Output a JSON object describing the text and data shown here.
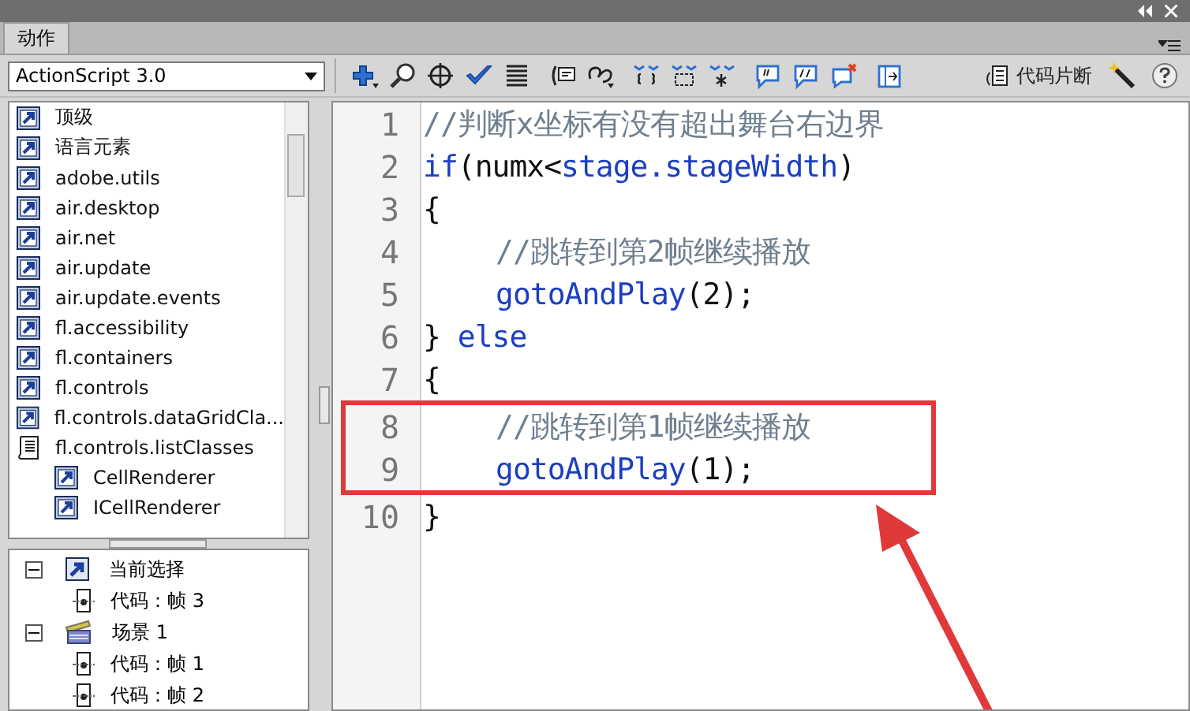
{
  "panel": {
    "tab": {
      "label": "动作",
      "selected": true
    }
  },
  "toolbar": {
    "version_select": {
      "value": "ActionScript 3.0"
    },
    "snippets_label": "代码片断"
  },
  "library": {
    "items": [
      {
        "label": "顶级",
        "kind": "package"
      },
      {
        "label": "语言元素",
        "kind": "package"
      },
      {
        "label": "adobe.utils",
        "kind": "package"
      },
      {
        "label": "air.desktop",
        "kind": "package"
      },
      {
        "label": "air.net",
        "kind": "package"
      },
      {
        "label": "air.update",
        "kind": "package"
      },
      {
        "label": "air.update.events",
        "kind": "package"
      },
      {
        "label": "fl.accessibility",
        "kind": "package"
      },
      {
        "label": "fl.containers",
        "kind": "package"
      },
      {
        "label": "fl.controls",
        "kind": "package"
      },
      {
        "label": "fl.controls.dataGridCla...",
        "kind": "package"
      },
      {
        "label": "fl.controls.listClasses",
        "kind": "book",
        "children": [
          {
            "label": "CellRenderer",
            "kind": "package"
          },
          {
            "label": "ICellRenderer",
            "kind": "package"
          }
        ]
      }
    ]
  },
  "script_navigator": {
    "items": [
      {
        "label": "当前选择",
        "kind": "selection",
        "expanded": true,
        "children": [
          {
            "label": "代码：帧 3",
            "kind": "frame"
          }
        ]
      },
      {
        "label": "场景 1",
        "kind": "scene",
        "expanded": true,
        "children": [
          {
            "label": "代码：帧 1",
            "kind": "frame"
          },
          {
            "label": "代码：帧 2",
            "kind": "frame"
          }
        ]
      }
    ]
  },
  "editor": {
    "lines": [
      {
        "number": "1",
        "highlighted": false,
        "tokens": [
          {
            "text": "//判断x坐标有没有超出舞台右边界",
            "kind": "comment"
          }
        ]
      },
      {
        "number": "2",
        "highlighted": false,
        "tokens": [
          {
            "text": "if",
            "kind": "keyword"
          },
          {
            "text": "(numx<",
            "kind": "plain"
          },
          {
            "text": "stage.stageWidth",
            "kind": "keyword"
          },
          {
            "text": ")",
            "kind": "plain"
          }
        ]
      },
      {
        "number": "3",
        "highlighted": false,
        "tokens": [
          {
            "text": "{",
            "kind": "plain"
          }
        ]
      },
      {
        "number": "4",
        "highlighted": false,
        "indented": true,
        "tokens": [
          {
            "text": "//跳转到第2帧继续播放",
            "kind": "comment"
          }
        ]
      },
      {
        "number": "5",
        "highlighted": false,
        "indented": true,
        "tokens": [
          {
            "text": "gotoAndPlay",
            "kind": "keyword"
          },
          {
            "text": "(2);",
            "kind": "plain"
          }
        ]
      },
      {
        "number": "6",
        "highlighted": false,
        "tokens": [
          {
            "text": "} ",
            "kind": "plain"
          },
          {
            "text": "else",
            "kind": "keyword"
          }
        ]
      },
      {
        "number": "7",
        "highlighted": false,
        "tokens": [
          {
            "text": "{",
            "kind": "plain"
          }
        ]
      },
      {
        "number": "8",
        "highlighted": true,
        "indented": true,
        "tokens": [
          {
            "text": "//跳转到第1帧继续播放",
            "kind": "comment"
          }
        ]
      },
      {
        "number": "9",
        "highlighted": true,
        "indented": true,
        "tokens": [
          {
            "text": "gotoAndPlay",
            "kind": "keyword"
          },
          {
            "text": "(1);",
            "kind": "plain"
          }
        ]
      },
      {
        "number": "10",
        "highlighted": false,
        "tokens": [
          {
            "text": "}",
            "kind": "plain"
          }
        ]
      }
    ]
  }
}
